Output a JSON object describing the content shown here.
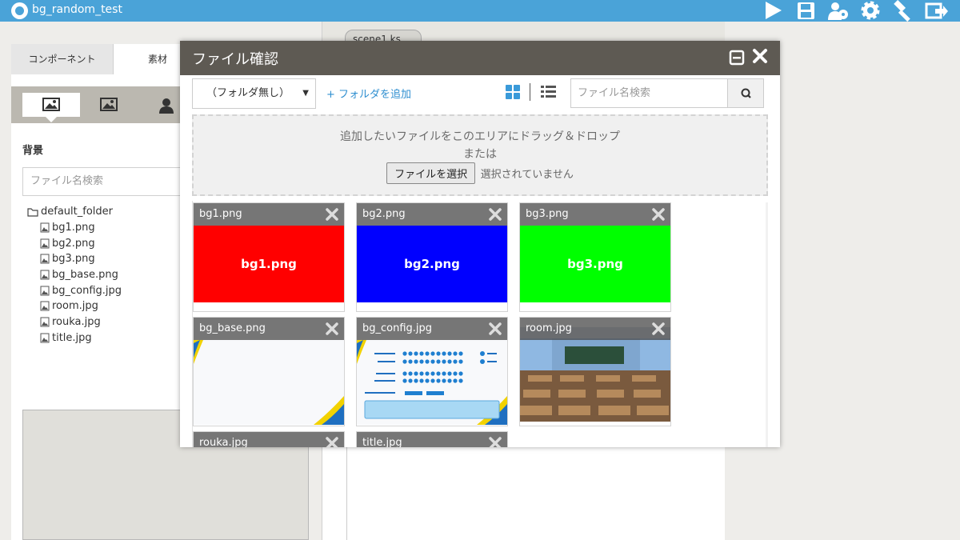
{
  "app": {
    "title": "bg_random_test",
    "colors": {
      "topbar": "#4aa3d8",
      "modal_header": "#5e5a53",
      "link": "#2f8fd0"
    }
  },
  "toolbar": {
    "icons": [
      "play-icon",
      "save-icon",
      "users-icon",
      "gear-icon",
      "hammer-icon",
      "export-icon"
    ]
  },
  "left_panel": {
    "tabs": [
      "コンポーネント",
      "素材"
    ],
    "section_title": "背景",
    "search_placeholder": "ファイル名検索",
    "folder": "default_folder",
    "files": [
      "bg1.png",
      "bg2.png",
      "bg3.png",
      "bg_base.png",
      "bg_config.jpg",
      "room.jpg",
      "rouka.jpg",
      "title.jpg"
    ]
  },
  "editor": {
    "scene_tab": "scene1.ks"
  },
  "modal": {
    "title": "ファイル確認",
    "folder_select": "（フォルダ無し）",
    "add_folder": "+ フォルダを追加",
    "search_placeholder": "ファイル名検索",
    "dropzone": {
      "line1": "追加したいファイルをこのエリアにドラッグ＆ドロップ",
      "line2": "または",
      "choose_button": "ファイルを選択",
      "no_file": "選択されていません"
    },
    "thumbnails": [
      {
        "name": "bg1.png",
        "color": "#ff0000",
        "caption": "bg1.png"
      },
      {
        "name": "bg2.png",
        "color": "#0000ff",
        "caption": "bg2.png"
      },
      {
        "name": "bg3.png",
        "color": "#00ff00",
        "caption": "bg3.png"
      },
      {
        "name": "bg_base.png"
      },
      {
        "name": "bg_config.jpg"
      },
      {
        "name": "room.jpg"
      },
      {
        "name": "rouka.jpg"
      },
      {
        "name": "title.jpg"
      }
    ]
  }
}
